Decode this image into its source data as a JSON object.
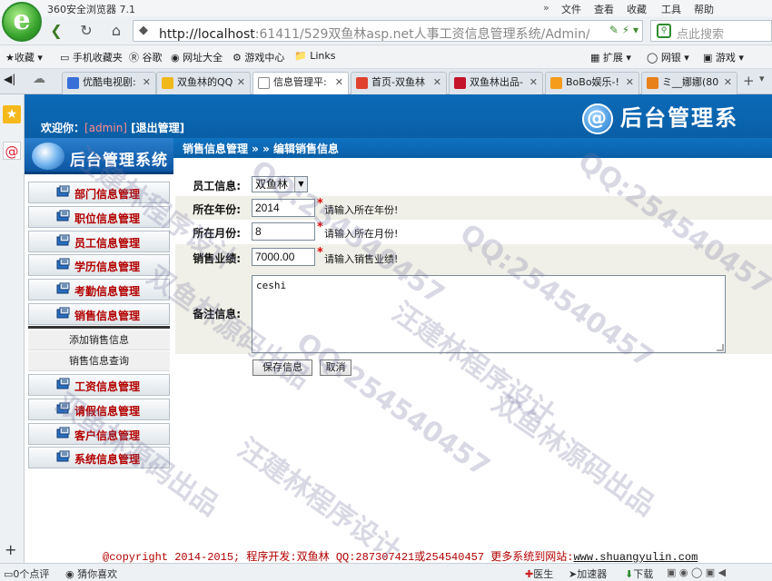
{
  "browser": {
    "app_title": "360安全浏览器 7.1",
    "menu": {
      "file": "文件",
      "view": "查看",
      "favorites": "收藏",
      "tools": "工具",
      "help": "帮助",
      "arrows": "»"
    },
    "address_host": "http://localhost",
    "address_rest": ":61411/529双鱼林asp.net人事工资信息管理系统/Admin/Ad",
    "search_placeholder": "点此搜索",
    "favorites_bar": [
      "收藏",
      "手机收藏夹",
      "谷歌",
      "网址大全",
      "游戏中心",
      "Links",
      "扩展",
      "网银",
      "游戏"
    ],
    "tabs": [
      {
        "label": "优酷电视剧:",
        "active": false,
        "color": "#3a6fd8"
      },
      {
        "label": "双鱼林的QQ",
        "active": false,
        "color": "#f1b81a"
      },
      {
        "label": "信息管理平:",
        "active": true,
        "color": "#ffffff"
      },
      {
        "label": "首页-双鱼林",
        "active": false,
        "color": "#e0412f"
      },
      {
        "label": "双鱼林出品-",
        "active": false,
        "color": "#c4142a"
      },
      {
        "label": "BoBo娱乐-!",
        "active": false,
        "color": "#f59c1a"
      },
      {
        "label": "ミ__娜娜(80",
        "active": false,
        "color": "#e8811a"
      }
    ]
  },
  "header": {
    "welcome_prefix": "欢迎你：",
    "user": "[admin]",
    "logout": "[退出管理]",
    "system_title": "后台管理系"
  },
  "sidebar": {
    "title": "后台管理系统",
    "items": [
      {
        "label": "部门信息管理"
      },
      {
        "label": "职位信息管理"
      },
      {
        "label": "员工信息管理"
      },
      {
        "label": "学历信息管理"
      },
      {
        "label": "考勤信息管理"
      },
      {
        "label": "销售信息管理"
      }
    ],
    "sub_items": [
      {
        "label": "添加销售信息"
      },
      {
        "label": "销售信息查询"
      }
    ],
    "items_after": [
      {
        "label": "工资信息管理"
      },
      {
        "label": "请假信息管理"
      },
      {
        "label": "客户信息管理"
      },
      {
        "label": "系统信息管理"
      }
    ]
  },
  "content": {
    "breadcrumb": "销售信息管理 » » 编辑销售信息",
    "form": {
      "employee": {
        "label": "员工信息:",
        "value": "双鱼林"
      },
      "year": {
        "label": "所在年份:",
        "value": "2014",
        "required": "*",
        "hint": "请输入所在年份!"
      },
      "month": {
        "label": "所在月份:",
        "value": "8",
        "required": "*",
        "hint": "请输入所在月份!"
      },
      "sales": {
        "label": "销售业绩:",
        "value": "7000.00",
        "required": "*",
        "hint": "请输入销售业绩!"
      },
      "memo": {
        "label": "备注信息:",
        "value": "ceshi"
      }
    },
    "save_button": "保存信息",
    "cancel_button": "取消"
  },
  "footer": {
    "copyright": "@copyright 2014-2015; 程序开发:双鱼林  QQ:287307421或254540457  更多系统到网站:",
    "link": "www.shuangyulin.com"
  },
  "statusbar": {
    "comments": "0个点评",
    "guess": "猜你喜欢",
    "doctor": "医生",
    "accelerator": "加速器",
    "download": "下载"
  },
  "watermarks": [
    "汪建林程序设计",
    "QQ:254540457",
    "双鱼林源码出品",
    "QQ:254540457",
    "汪建林程序设计",
    "QQ:254540457",
    "双鱼林源码出品",
    "汪建林程序设计",
    "QQ:254540457",
    "双鱼林源码出品"
  ]
}
